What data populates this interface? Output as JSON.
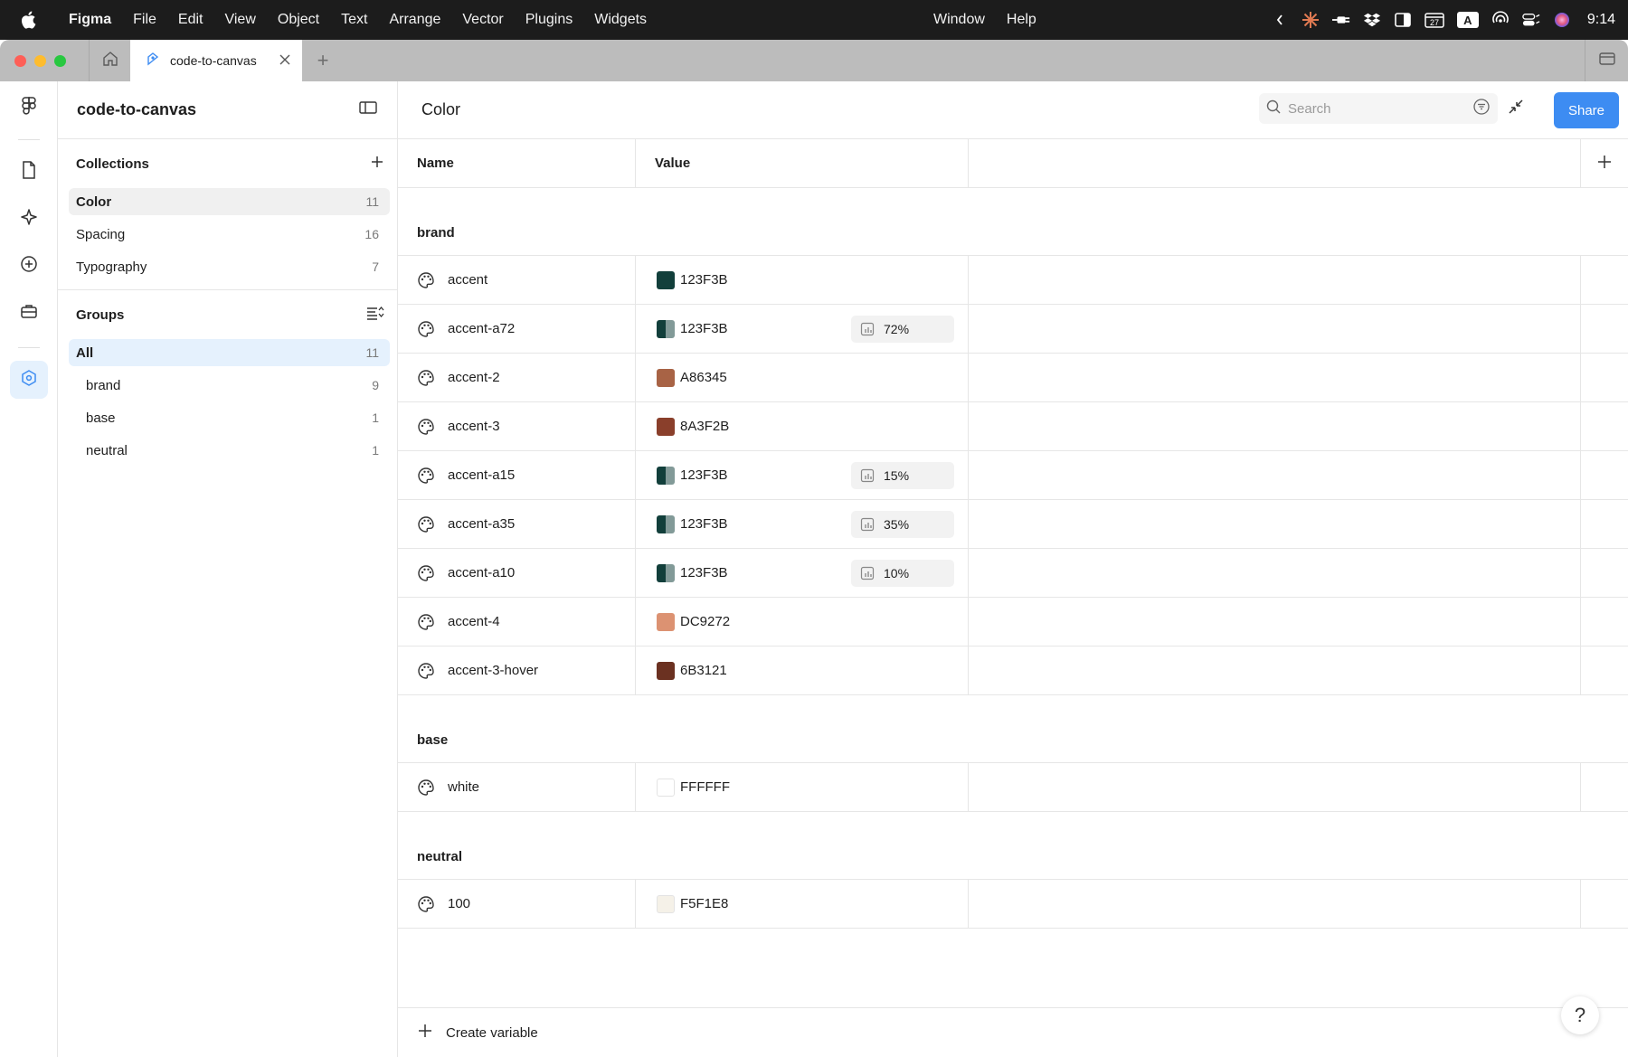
{
  "menubar": {
    "app": "Figma",
    "items": [
      "File",
      "Edit",
      "View",
      "Object",
      "Text",
      "Arrange",
      "Vector",
      "Plugins",
      "Widgets"
    ],
    "right_items": [
      "Window",
      "Help"
    ],
    "clock": "9:14",
    "calendar_day": "27",
    "input_source": "A"
  },
  "tabs": {
    "file_tab": "code-to-canvas",
    "new_tab": "+"
  },
  "sidebar": {
    "project": "code-to-canvas",
    "collections_title": "Collections",
    "collections": [
      {
        "label": "Color",
        "count": "11"
      },
      {
        "label": "Spacing",
        "count": "16"
      },
      {
        "label": "Typography",
        "count": "7"
      }
    ],
    "groups_title": "Groups",
    "groups": [
      {
        "label": "All",
        "count": "11"
      },
      {
        "label": "brand",
        "count": "9"
      },
      {
        "label": "base",
        "count": "1"
      },
      {
        "label": "neutral",
        "count": "1"
      }
    ]
  },
  "main": {
    "title": "Color",
    "search_placeholder": "Search",
    "share": "Share",
    "col_name": "Name",
    "col_value": "Value",
    "groups": [
      {
        "label": "brand",
        "rows": [
          {
            "name": "accent",
            "hex": "123F3B",
            "color": "#123F3B"
          },
          {
            "name": "accent-a72",
            "hex": "123F3B",
            "color": "#123F3B",
            "alpha": "72%"
          },
          {
            "name": "accent-2",
            "hex": "A86345",
            "color": "#A86345"
          },
          {
            "name": "accent-3",
            "hex": "8A3F2B",
            "color": "#8A3F2B"
          },
          {
            "name": "accent-a15",
            "hex": "123F3B",
            "color": "#123F3B",
            "alpha": "15%"
          },
          {
            "name": "accent-a35",
            "hex": "123F3B",
            "color": "#123F3B",
            "alpha": "35%"
          },
          {
            "name": "accent-a10",
            "hex": "123F3B",
            "color": "#123F3B",
            "alpha": "10%"
          },
          {
            "name": "accent-4",
            "hex": "DC9272",
            "color": "#DC9272"
          },
          {
            "name": "accent-3-hover",
            "hex": "6B3121",
            "color": "#6B3121"
          }
        ]
      },
      {
        "label": "base",
        "rows": [
          {
            "name": "white",
            "hex": "FFFFFF",
            "color": "#FFFFFF"
          }
        ]
      },
      {
        "label": "neutral",
        "rows": [
          {
            "name": "100",
            "hex": "F5F1E8",
            "color": "#F5F1E8"
          }
        ]
      }
    ],
    "create_variable": "Create variable",
    "help": "?"
  }
}
